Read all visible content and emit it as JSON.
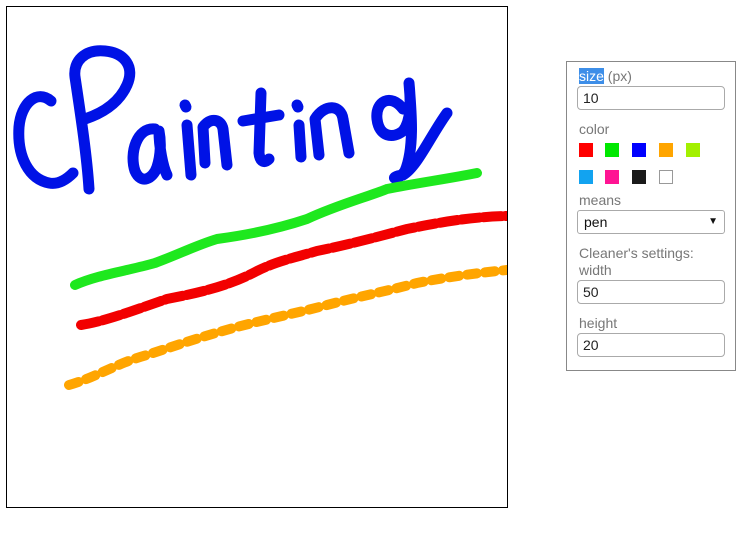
{
  "canvas": {
    "strokes": [
      {
        "name": "blue-handwriting-stroke",
        "color": "#0012e6"
      },
      {
        "name": "green-line-stroke",
        "color": "#1ee81e"
      },
      {
        "name": "red-line-stroke",
        "color": "#f20000"
      },
      {
        "name": "orange-dotted-stroke",
        "color": "#ffa500"
      }
    ]
  },
  "panel": {
    "size_label_highlight": "size",
    "size_label_unit": " (px)",
    "size_value": "10",
    "color_label": "color",
    "colors": [
      "#ff0000",
      "#00e800",
      "#0000ff",
      "#ffa500",
      "#a3f000",
      "#12a3f0",
      "#ff1493",
      "#1a1a1a",
      "#ffffff"
    ],
    "means_label": "means",
    "means_value": "pen",
    "cleaner_label": "Cleaner's settings:",
    "width_label": "width",
    "width_value": "50",
    "height_label": "height",
    "height_value": "20"
  }
}
